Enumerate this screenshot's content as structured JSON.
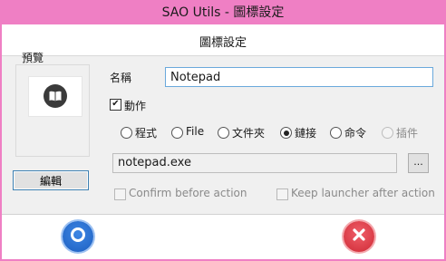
{
  "window": {
    "title": "SAO Utils - 圖標設定"
  },
  "dialog": {
    "header_title": "圖標設定"
  },
  "preview": {
    "label": "預覽",
    "icon": "book-icon",
    "edit_button": "編輯"
  },
  "name": {
    "label": "名稱",
    "value": "Notepad"
  },
  "action": {
    "checkbox_label": "動作",
    "checked": true,
    "types": [
      {
        "label": "程式",
        "selected": false,
        "enabled": true
      },
      {
        "label": "File",
        "selected": false,
        "enabled": true
      },
      {
        "label": "文件夾",
        "selected": false,
        "enabled": true
      },
      {
        "label": "鏈接",
        "selected": true,
        "enabled": true
      },
      {
        "label": "命令",
        "selected": false,
        "enabled": true
      },
      {
        "label": "插件",
        "selected": false,
        "enabled": false
      }
    ],
    "target": "notepad.exe",
    "browse_label": "..."
  },
  "options": {
    "confirm_before_action": "Confirm before action",
    "keep_launcher_after_action": "Keep launcher after action"
  },
  "footer": {
    "ok_icon": "circle-ok-icon",
    "cancel_icon": "x-cancel-icon"
  },
  "colors": {
    "titlebar": "#ef7fc4",
    "accent_blue": "#2f74d0",
    "accent_red": "#e0404a"
  }
}
